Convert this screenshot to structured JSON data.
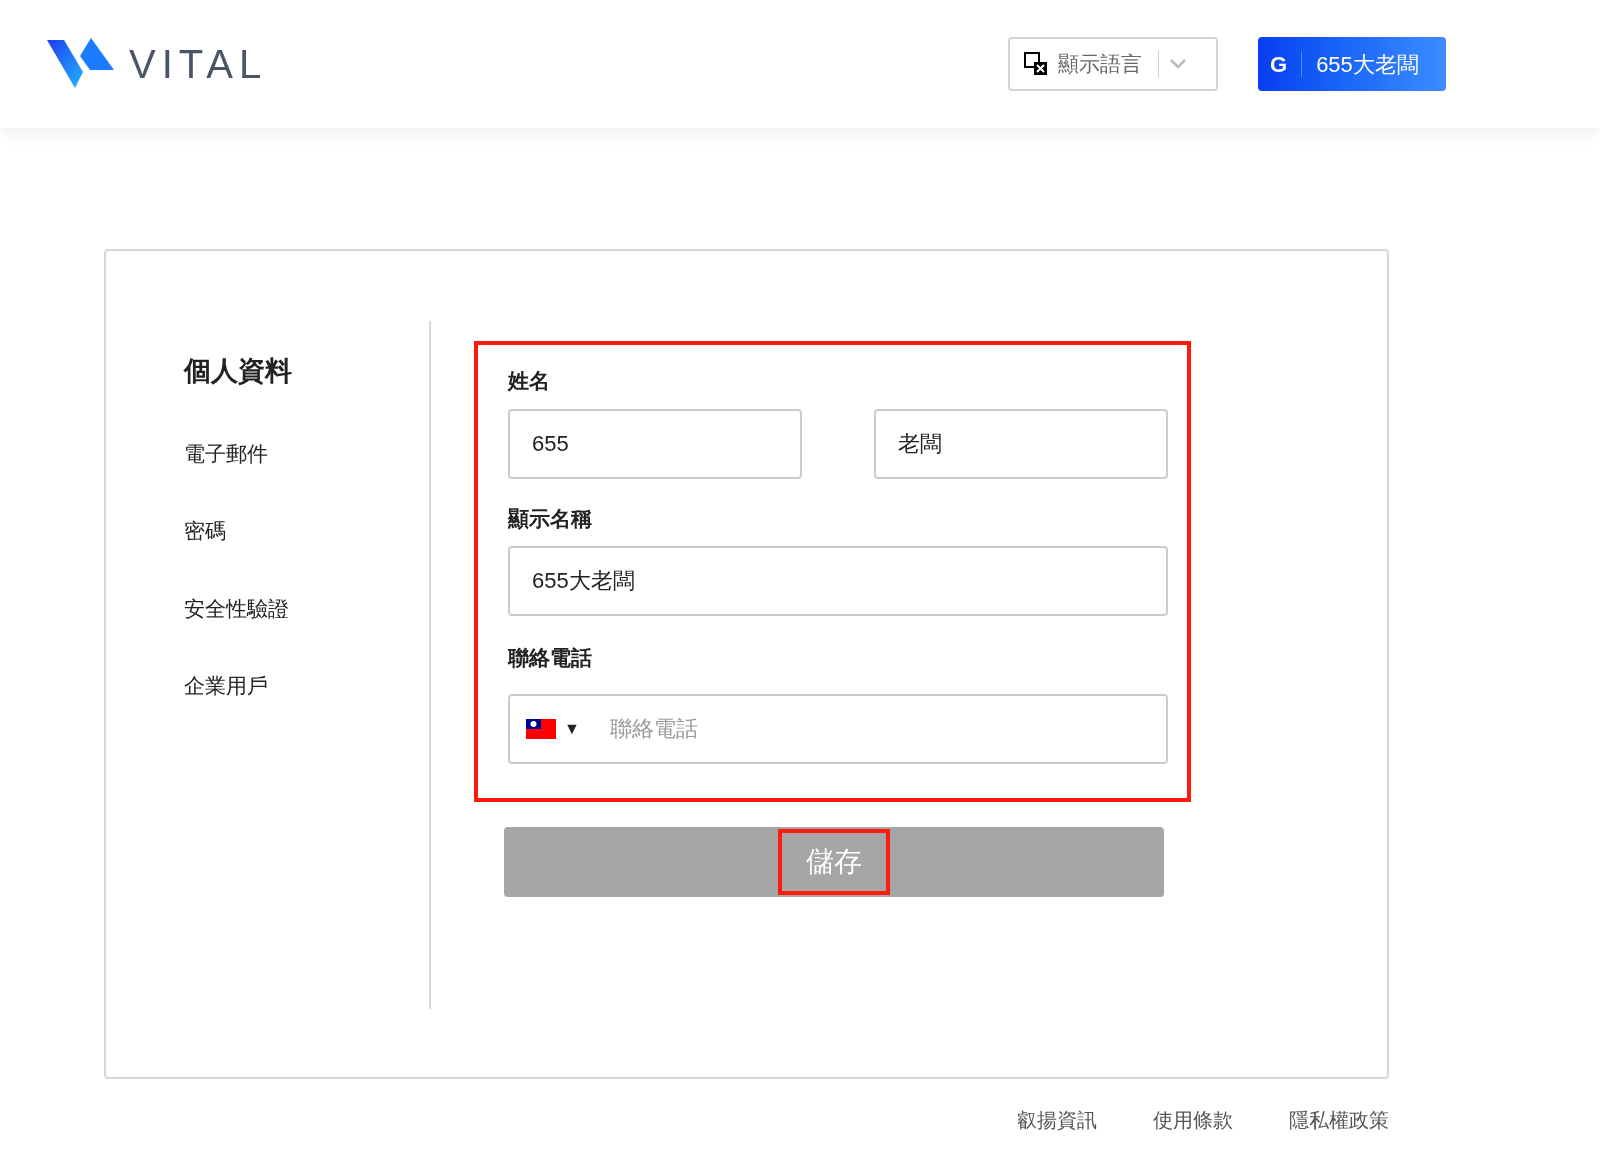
{
  "header": {
    "logo_text": "VITAL",
    "language_selector": {
      "label": "顯示語言"
    },
    "user_button": {
      "initial": "G",
      "name": "655大老闆"
    }
  },
  "sidebar": {
    "items": [
      {
        "label": "個人資料",
        "selected": true
      },
      {
        "label": "電子郵件",
        "selected": false
      },
      {
        "label": "密碼",
        "selected": false
      },
      {
        "label": "安全性驗證",
        "selected": false
      },
      {
        "label": "企業用戶",
        "selected": false
      }
    ]
  },
  "form": {
    "highlighted": true,
    "name_label": "姓名",
    "first_name": "655",
    "last_name": "老闆",
    "display_name_label": "顯示名稱",
    "display_name": "655大老闆",
    "phone_label": "聯絡電話",
    "phone_placeholder": "聯絡電話",
    "phone_country_arrow": "▼"
  },
  "save_button": {
    "label": "儲存",
    "disabled": true,
    "highlighted": true
  },
  "footer": {
    "links": [
      "叡揚資訊",
      "使用條款",
      "隱私權政策"
    ]
  }
}
